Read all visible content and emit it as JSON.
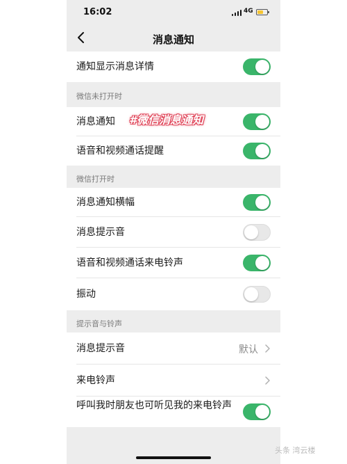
{
  "status_bar": {
    "time": "16:02",
    "network": "4G",
    "battery_level": 0.55
  },
  "nav": {
    "back_icon": "chevron-left-icon",
    "title": "消息通知"
  },
  "rows": {
    "show_details": {
      "label": "通知显示消息详情",
      "on": true
    },
    "section_closed": "微信未打开时",
    "msg_notify": {
      "label": "消息通知",
      "on": true
    },
    "voice_video_remind": {
      "label": "语音和视频通话提醒",
      "on": true
    },
    "section_open": "微信打开时",
    "banner": {
      "label": "消息通知横幅",
      "on": true
    },
    "msg_sound": {
      "label": "消息提示音",
      "on": false
    },
    "call_ringtone": {
      "label": "语音和视频通话来电铃声",
      "on": true
    },
    "vibrate": {
      "label": "振动",
      "on": false
    },
    "section_sounds": "提示音与铃声",
    "msg_tone": {
      "label": "消息提示音",
      "value": "默认"
    },
    "incoming_ringtone": {
      "label": "来电铃声"
    },
    "friends_hear": {
      "label": "呼叫我时朋友也可听见我的来电铃声",
      "on": true
    }
  },
  "overlay": {
    "hashtag": "#微信消息通知"
  },
  "watermark": "头条 湾云楼",
  "colors": {
    "toggle_on": "#3ab56a",
    "toggle_off": "#e8e8e8",
    "background": "#ededed",
    "hashtag_outline": "#e0465a"
  }
}
